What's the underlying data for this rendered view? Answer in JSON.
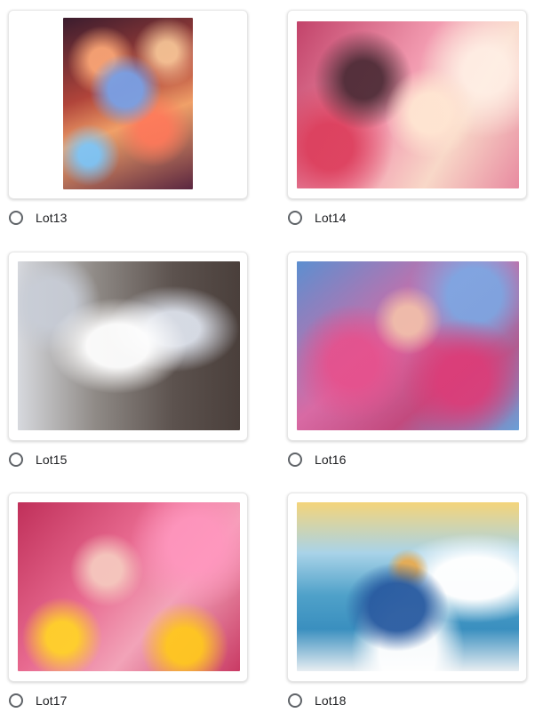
{
  "options": [
    {
      "label": "Lot13",
      "image_icon": "anime-couple-embrace-swirl-painting"
    },
    {
      "label": "Lot14",
      "image_icon": "anime-family-hug-cherry-blossom-painting"
    },
    {
      "label": "Lot15",
      "image_icon": "crystal-glass-figures-painting"
    },
    {
      "label": "Lot16",
      "image_icon": "woman-pink-flowers-blue-sky-painting"
    },
    {
      "label": "Lot17",
      "image_icon": "woman-pink-yellow-flowers-painting"
    },
    {
      "label": "Lot18",
      "image_icon": "corgi-blue-car-ocean-wave-painting"
    }
  ],
  "colors": {
    "radio_border": "#5f6368",
    "label_text": "#202124",
    "card_border": "#e6e6e6"
  }
}
